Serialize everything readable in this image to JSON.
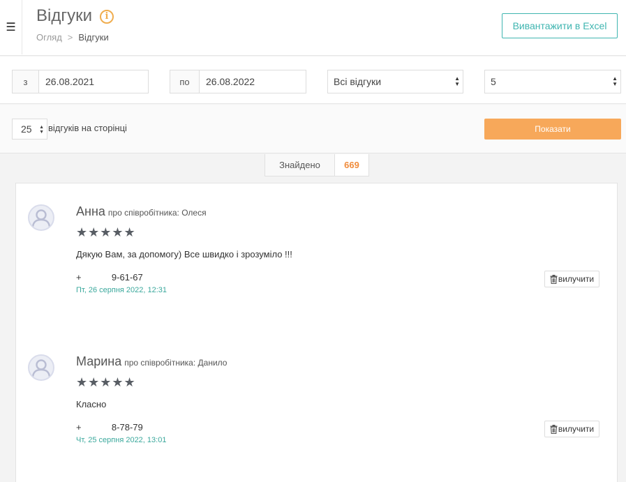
{
  "header": {
    "title": "Відгуки",
    "breadcrumb": {
      "home": "Огляд",
      "separator": ">",
      "current": "Відгуки"
    },
    "export_label": "Вивантажити в Excel"
  },
  "filters": {
    "from_label": "з",
    "from_value": "26.08.2021",
    "to_label": "по",
    "to_value": "26.08.2022",
    "type_selected": "Всі відгуки",
    "rating_selected": "5"
  },
  "pagination": {
    "per_page": "25",
    "per_page_label": "відгуків на сторінці",
    "show_label": "Показати"
  },
  "results": {
    "found_label": "Знайдено",
    "found_count": "669"
  },
  "reviews": [
    {
      "name": "Анна",
      "about": "про співробітника: Олеся",
      "rating": 5,
      "stars": "★★★★★",
      "text": "Дякую Вам, за допомогу) Все швидко і зрозуміло !!!",
      "phone": "+            9-61-67",
      "date": "Пт, 26 серпня 2022, 12:31",
      "delete_label": "вилучити"
    },
    {
      "name": "Марина",
      "about": "про співробітника: Данило",
      "rating": 5,
      "stars": "★★★★★",
      "text": "Класно",
      "phone": "+            8-78-79",
      "date": "Чт, 25 серпня 2022, 13:01",
      "delete_label": "вилучити"
    }
  ],
  "colors": {
    "accent_teal": "#3fb5b0",
    "accent_orange": "#f7a85a",
    "count_orange": "#f08c3c",
    "date_green": "#3aa89c",
    "info_icon": "#f0ad4e"
  }
}
